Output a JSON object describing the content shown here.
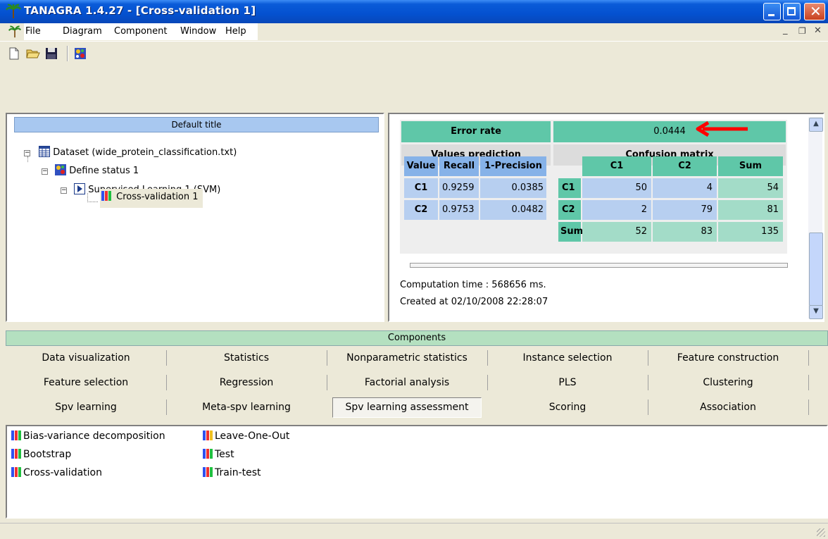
{
  "window": {
    "title": "TANAGRA 1.4.27 - [Cross-validation 1]"
  },
  "menu": [
    "File",
    "Diagram",
    "Component",
    "Window",
    "Help"
  ],
  "toolbar": [
    "new-icon",
    "open-icon",
    "save-icon",
    "diagram-icon"
  ],
  "tree": {
    "header": "Default title",
    "nodes": [
      {
        "label": "Dataset (wide_protein_classification.txt)"
      },
      {
        "label": "Define status 1"
      },
      {
        "label": "Supervised Learning 1 (SVM)"
      },
      {
        "label": "Cross-validation 1"
      }
    ]
  },
  "results": {
    "error_rate_label": "Error rate",
    "error_rate_value": "0.0444",
    "values_prediction": "Values prediction",
    "confusion_matrix": "Confusion matrix",
    "vp_headers": [
      "Value",
      "Recall",
      "1-Precision"
    ],
    "vp_rows": [
      [
        "C1",
        "0.9259",
        "0.0385"
      ],
      [
        "C2",
        "0.9753",
        "0.0482"
      ]
    ],
    "cm_headers": [
      "C1",
      "C2",
      "Sum"
    ],
    "cm_rows": [
      [
        "C1",
        "50",
        "4",
        "54"
      ],
      [
        "C2",
        "2",
        "79",
        "81"
      ],
      [
        "Sum",
        "52",
        "83",
        "135"
      ]
    ],
    "computation_time": "Computation time : 568656 ms.",
    "created_at": "Created at 02/10/2008 22:28:07"
  },
  "components": {
    "header": "Components",
    "tabs": [
      [
        "Data visualization",
        "Statistics",
        "Nonparametric statistics",
        "Instance selection",
        "Feature construction"
      ],
      [
        "Feature selection",
        "Regression",
        "Factorial analysis",
        "PLS",
        "Clustering"
      ],
      [
        "Spv learning",
        "Meta-spv learning",
        "Spv learning assessment",
        "Scoring",
        "Association"
      ]
    ],
    "active_tab": "Spv learning assessment",
    "items": [
      "Bias-variance decomposition",
      "Leave-One-Out",
      "Bootstrap",
      "Test",
      "Cross-validation",
      "Train-test"
    ]
  }
}
